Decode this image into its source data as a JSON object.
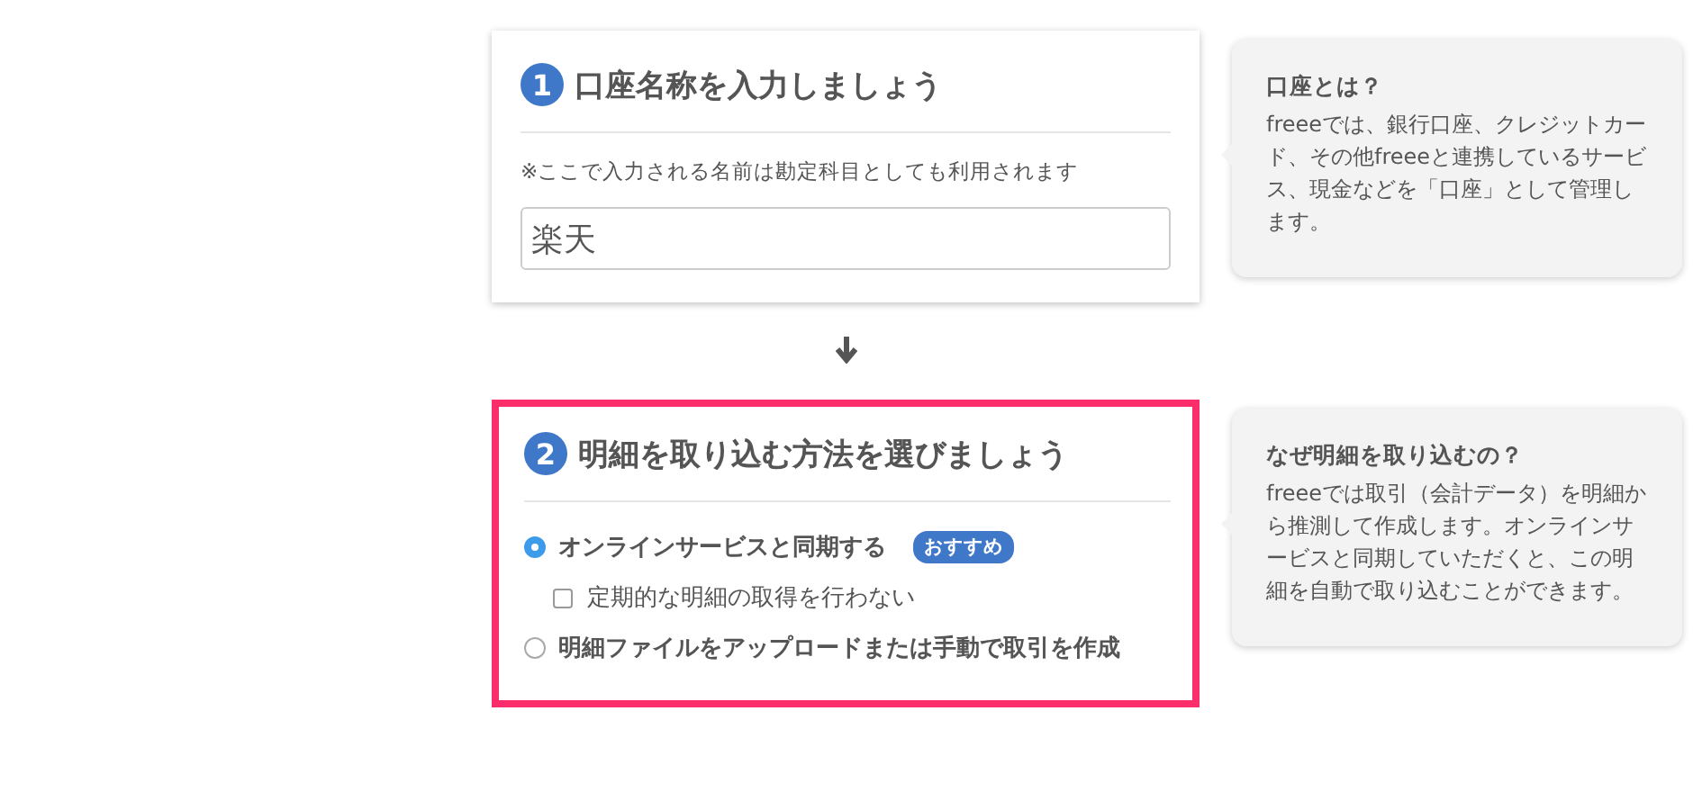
{
  "steps": [
    {
      "number": "1",
      "title": "口座名称を入力しましょう",
      "highlighted": false,
      "note": "※ここで入力される名前は勘定科目としても利用されます",
      "input": {
        "value": "楽天"
      },
      "help": {
        "title": "口座とは？",
        "body": "freeeでは、銀行口座、クレジットカード、その他freeeと連携しているサービス、現金などを「口座」として管理します。"
      }
    },
    {
      "number": "2",
      "title": "明細を取り込む方法を選びましょう",
      "highlighted": true,
      "options": [
        {
          "kind": "radio",
          "label": "オンラインサービスと同期する",
          "selected": true,
          "badge": "おすすめ",
          "children": [
            {
              "kind": "checkbox",
              "label": "定期的な明細の取得を行わない",
              "checked": false
            }
          ]
        },
        {
          "kind": "radio",
          "label": "明細ファイルをアップロードまたは手動で取引を作成",
          "selected": false
        }
      ],
      "help": {
        "title": "なぜ明細を取り込むの？",
        "body": "freeeでは取引（会計データ）を明細から推測して作成します。オンラインサービスと同期していただくと、この明細を自動で取り込むことができます。"
      }
    }
  ]
}
